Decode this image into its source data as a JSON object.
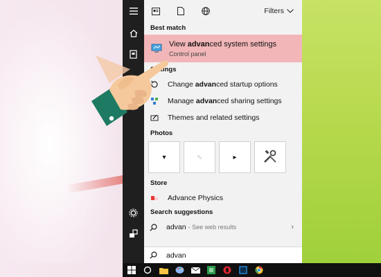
{
  "toolbar": {
    "filters_label": "Filters"
  },
  "sections": {
    "best_match": "Best match",
    "settings": "Settings",
    "photos": "Photos",
    "store": "Store",
    "search_suggestions": "Search suggestions"
  },
  "best_match": {
    "title_pre": "View ",
    "title_hl": "advan",
    "title_post": "ced system settings",
    "subtitle": "Control panel"
  },
  "settings_items": [
    {
      "pre": "Change ",
      "hl": "advan",
      "post": "ced startup options"
    },
    {
      "pre": "Manage ",
      "hl": "advan",
      "post": "ced sharing settings"
    },
    {
      "pre": "Themes and related settings",
      "hl": "",
      "post": ""
    }
  ],
  "store_item": "Advance Physics",
  "suggestion": {
    "text": "advan",
    "hint": "- See web results"
  },
  "search": {
    "value": "advan"
  },
  "colors": {
    "highlight": "#f2b6b8",
    "rail": "#1f1f1f",
    "panel": "#f2f2f2",
    "taskbar": "#101010"
  },
  "icons": {
    "rail": [
      "hamburger-icon",
      "home-icon",
      "tablet-icon",
      "settings-icon",
      "user-icon"
    ],
    "top": [
      "document-list-icon",
      "file-icon",
      "globe-icon"
    ],
    "taskbar": [
      "windows-start-icon",
      "cortana-circle-icon",
      "folder-icon",
      "paint-icon",
      "mail-icon",
      "green-app-icon",
      "opera-icon",
      "photoshop-icon",
      "chrome-icon"
    ]
  }
}
